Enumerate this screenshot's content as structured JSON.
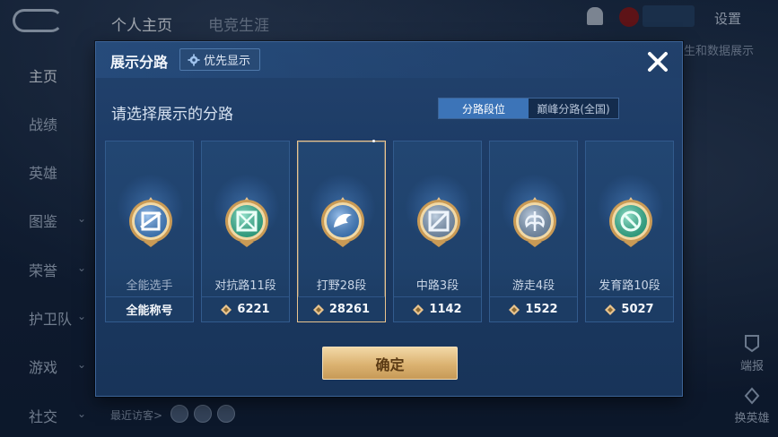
{
  "background": {
    "top_tabs": [
      "个人主页",
      "电竞生涯"
    ],
    "settings_label": "设置",
    "nav_items": [
      {
        "label": "主页",
        "has_chevron": false
      },
      {
        "label": "战绩",
        "has_chevron": false
      },
      {
        "label": "英雄",
        "has_chevron": false
      },
      {
        "label": "图鉴",
        "has_chevron": true
      },
      {
        "label": "荣誉",
        "has_chevron": true
      },
      {
        "label": "护卫队",
        "has_chevron": true
      },
      {
        "label": "游戏",
        "has_chevron": true
      },
      {
        "label": "社交",
        "has_chevron": true
      }
    ],
    "right_text": "生和数据展示",
    "report_label": "端报",
    "switch_hero_label": "换英雄",
    "recent_visitors_label": "最近访客>"
  },
  "modal": {
    "title": "展示分路",
    "priority_button": "优先显示",
    "subtitle": "请选择展示的分路",
    "segment_options": [
      "分路段位",
      "巅峰分路(全国)"
    ],
    "active_segment": 0,
    "cards": [
      {
        "rank": "全能选手",
        "score": "全能称号",
        "show_icon": false,
        "selected": false,
        "emblem": "allround-emblem",
        "color": "#4a90e0"
      },
      {
        "rank": "对抗路11段",
        "score": "6221",
        "show_icon": true,
        "selected": false,
        "emblem": "clash-lane-emblem",
        "color": "#39c8a0"
      },
      {
        "rank": "打野28段",
        "score": "28261",
        "show_icon": true,
        "selected": true,
        "emblem": "jungle-emblem",
        "color": "#4a90e0"
      },
      {
        "rank": "中路3段",
        "score": "1142",
        "show_icon": true,
        "selected": false,
        "emblem": "mid-lane-emblem",
        "color": "#8aa7c8"
      },
      {
        "rank": "游走4段",
        "score": "1522",
        "show_icon": true,
        "selected": false,
        "emblem": "roam-emblem",
        "color": "#8aa7c8"
      },
      {
        "rank": "发育路10段",
        "score": "5027",
        "show_icon": true,
        "selected": false,
        "emblem": "farm-lane-emblem",
        "color": "#39c8a0"
      }
    ],
    "confirm_button": "确定"
  },
  "colors": {
    "accent_blue": "#3c74b8",
    "gold": "#dbb271",
    "selected_border": "#e9c48e"
  }
}
